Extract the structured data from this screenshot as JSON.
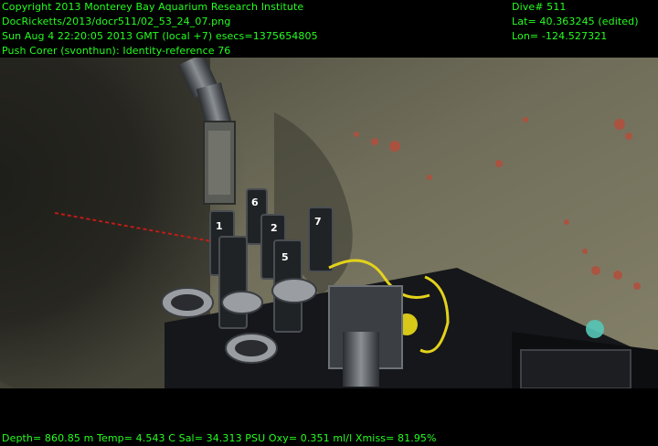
{
  "header": {
    "left_lines": [
      "Copyright 2013 Monterey Bay Aquarium Research Institute",
      "DocRicketts/2013/docr511/02_53_24_07.png",
      "Sun Aug  4 22:20:05 2013 GMT (local +7)  esecs=1375654805",
      "Push Corer (svonthun): Identity-reference 76"
    ],
    "right_lines": [
      "Dive# 511",
      "Lat= 40.363245 (edited)",
      "Lon= -124.527321"
    ]
  },
  "footer": {
    "telemetry": "Depth= 860.85 m  Temp= 4.543 C  Sal= 34.313 PSU  Oxy= 0.351 ml/l  Xmiss= 81.95%"
  },
  "scene": {
    "tube_labels": [
      "6",
      "2",
      "1",
      "7",
      "5"
    ],
    "colors": {
      "text": "#25ff1f",
      "seafloor": "#7a7762",
      "sediment_cloud": "#3a3a32",
      "laser": "#d21a14"
    }
  }
}
